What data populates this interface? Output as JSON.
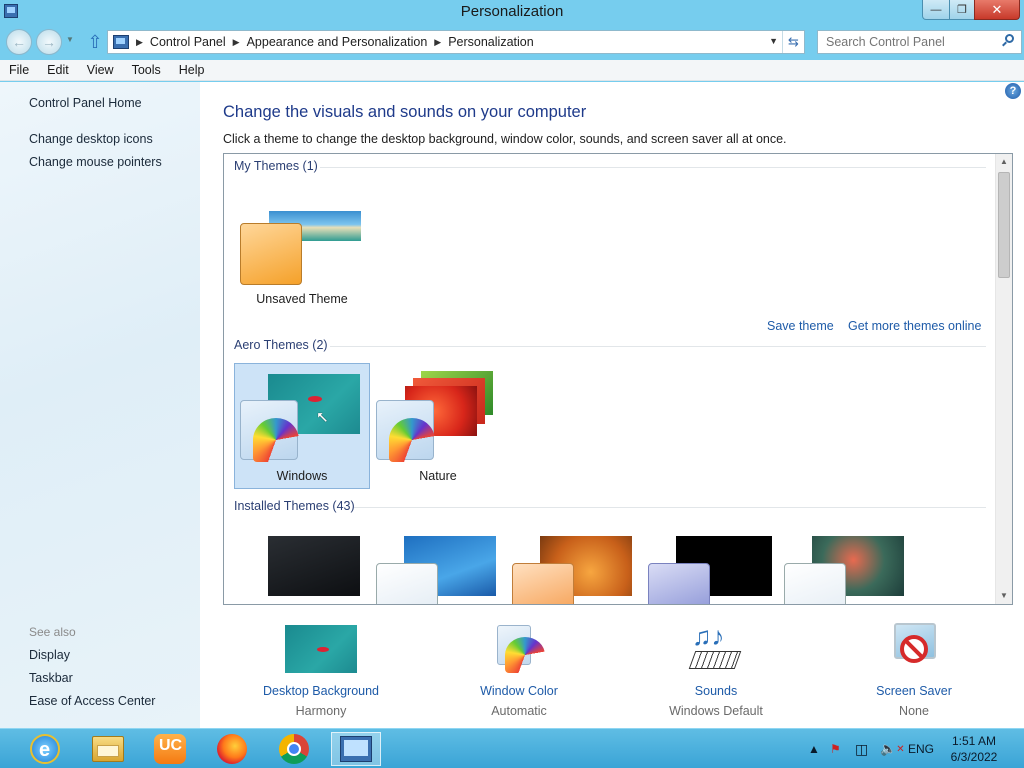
{
  "window": {
    "title": "Personalization"
  },
  "address": {
    "crumbs": [
      "Control Panel",
      "Appearance and Personalization",
      "Personalization"
    ]
  },
  "search": {
    "placeholder": "Search Control Panel"
  },
  "menu": [
    "File",
    "Edit",
    "View",
    "Tools",
    "Help"
  ],
  "sidebar": {
    "home": "Control Panel Home",
    "tasks": [
      "Change desktop icons",
      "Change mouse pointers"
    ],
    "see_also_label": "See also",
    "see_also": [
      "Display",
      "Taskbar",
      "Ease of Access Center"
    ]
  },
  "main": {
    "heading": "Change the visuals and sounds on your computer",
    "subheading": "Click a theme to change the desktop background, window color, sounds, and screen saver all at once.",
    "groups": {
      "my": "My Themes (1)",
      "aero": "Aero Themes (2)",
      "installed": "Installed Themes (43)"
    },
    "my_themes": [
      "Unsaved Theme"
    ],
    "aero_themes": [
      "Windows",
      "Nature"
    ],
    "selected_theme": "Windows",
    "save_theme": "Save theme",
    "get_more": "Get more themes online"
  },
  "settings": [
    {
      "label": "Desktop Background",
      "value": "Harmony"
    },
    {
      "label": "Window Color",
      "value": "Automatic"
    },
    {
      "label": "Sounds",
      "value": "Windows Default"
    },
    {
      "label": "Screen Saver",
      "value": "None"
    }
  ],
  "taskbar": {
    "apps": [
      "internet-explorer",
      "file-explorer",
      "uc-browser",
      "firefox",
      "chrome",
      "control-panel"
    ],
    "language": "ENG",
    "time": "1:51 AM",
    "date": "6/3/2022"
  },
  "colors": {
    "accent_link": "#1e5ba8",
    "heading": "#1e3a8a",
    "chrome": "#76cdee",
    "selected_tile": "#cde3f7"
  }
}
